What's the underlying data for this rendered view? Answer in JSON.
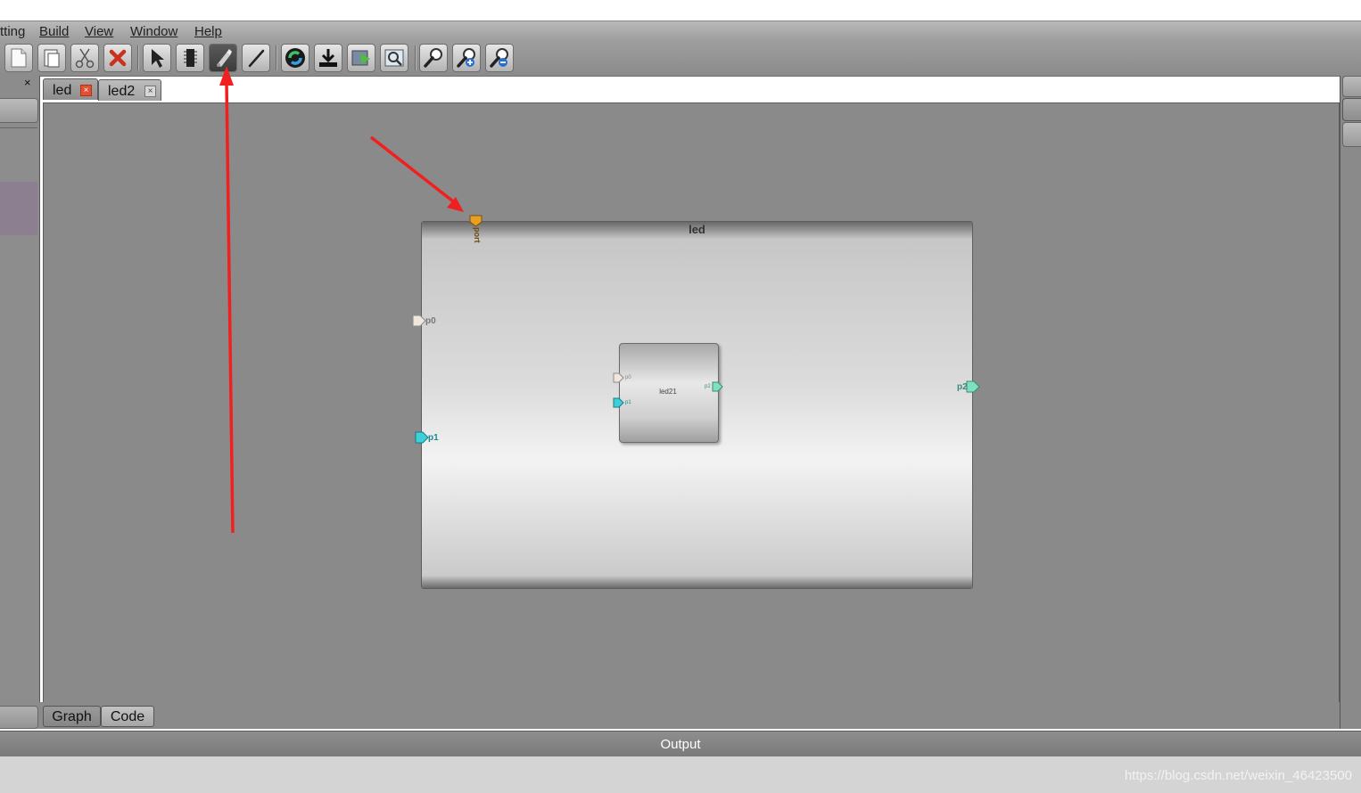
{
  "menu": {
    "items": [
      {
        "label": "tting",
        "accel": false
      },
      {
        "label": "Build",
        "accel": true
      },
      {
        "label": "View",
        "accel": true
      },
      {
        "label": "Window",
        "accel": true
      },
      {
        "label": "Help",
        "accel": true
      }
    ]
  },
  "toolbar": {
    "buttons": [
      {
        "icon": "new-file-icon"
      },
      {
        "icon": "paste-icon"
      },
      {
        "icon": "cut-icon"
      },
      {
        "icon": "delete-icon"
      },
      {
        "icon": "select-pointer-icon"
      },
      {
        "icon": "chip-icon"
      },
      {
        "icon": "port-tool-icon",
        "active": true
      },
      {
        "icon": "wire-icon"
      },
      {
        "icon": "refresh-icon"
      },
      {
        "icon": "download-icon"
      },
      {
        "icon": "run-icon"
      },
      {
        "icon": "zoom-fit-icon"
      },
      {
        "icon": "zoom-icon"
      },
      {
        "icon": "zoom-in-icon"
      },
      {
        "icon": "zoom-out-icon"
      }
    ]
  },
  "leftpanel": {
    "close_label": "×"
  },
  "tabs": [
    {
      "label": "led",
      "active": true,
      "close": "×"
    },
    {
      "label": "led2",
      "active": false,
      "close": "×"
    }
  ],
  "module": {
    "title": "led",
    "top_port": {
      "label": "port"
    },
    "ports": {
      "p0": "p0",
      "p1": "p1",
      "p2": "p2"
    },
    "inner": {
      "name": "led21",
      "ports": {
        "p0": "p0",
        "p1": "p1",
        "p2": "p2"
      }
    },
    "colors": {
      "input": "#f0e6dc",
      "clock": "#3ed0d8",
      "output": "#7fe0c0",
      "top": "#e8a020"
    }
  },
  "view_tabs": [
    {
      "label": "Graph",
      "active": true
    },
    {
      "label": "Code",
      "active": false
    }
  ],
  "output": {
    "title": "Output",
    "watermark": "https://blog.csdn.net/weixin_46423500"
  },
  "annotation_color": "#f02020"
}
